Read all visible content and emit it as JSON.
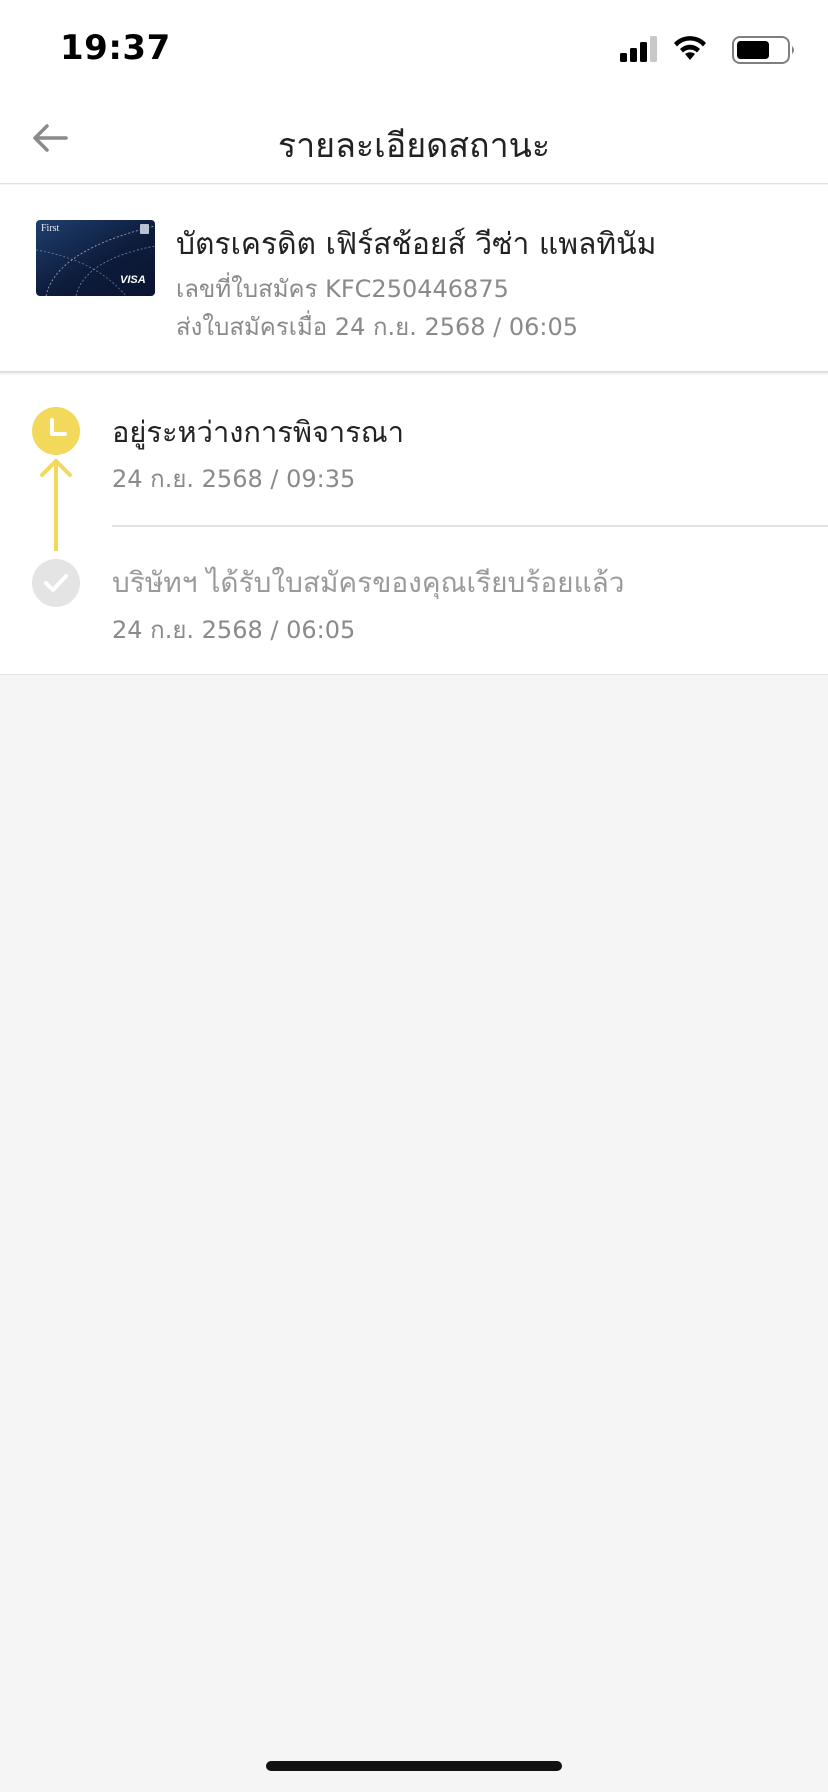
{
  "status_bar": {
    "time": "19:37"
  },
  "header": {
    "title": "รายละเอียดสถานะ",
    "back_icon": "arrow-left-icon"
  },
  "application": {
    "card_name": "บัตรเครดิต เฟิร์สช้อยส์ วีซ่า แพลทินัม",
    "application_number": "เลขที่ใบสมัคร KFC250446875",
    "submitted_at": "ส่งใบสมัครเมื่อ 24 ก.ย. 2568 / 06:05",
    "card_image_text": "First"
  },
  "timeline": [
    {
      "title": "อยู่ระหว่างการพิจารณา",
      "datetime": "24 ก.ย. 2568 / 09:35",
      "icon": "clock-icon",
      "status": "current"
    },
    {
      "title": "บริษัทฯ ได้รับใบสมัครของคุณเรียบร้อยแล้ว",
      "datetime": "24 ก.ย. 2568 / 06:05",
      "icon": "check-icon",
      "status": "done"
    }
  ],
  "colors": {
    "accent_yellow": "#f2d95c",
    "done_gray": "#e4e4e4",
    "background": "#f5f5f5"
  }
}
